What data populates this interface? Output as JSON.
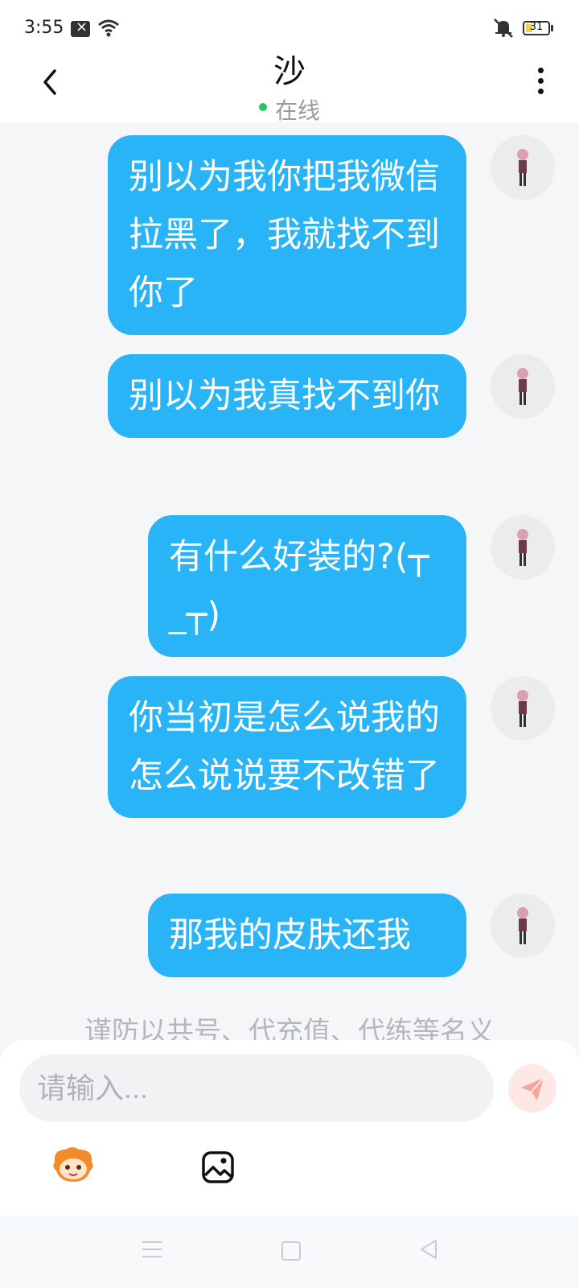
{
  "status_bar": {
    "time": "3:55",
    "battery": "31",
    "battery_level": 0.31
  },
  "header": {
    "title": "沙",
    "status": "在线",
    "icons": [
      "back-icon",
      "more-icon"
    ]
  },
  "messages": [
    {
      "text": "别以为我你把我微信拉黑了，我就找不到你了"
    },
    {
      "text": "别以为我真找不到你"
    },
    {
      "text": "有什么好装的?(┬_┬)"
    },
    {
      "text": "你当初是怎么说我的怎么说说要不改错了"
    },
    {
      "text": "那我的皮肤还我"
    }
  ],
  "notice": "谨防以共号、代充值、代练等名义",
  "composer": {
    "placeholder": "请输入...",
    "icons": [
      "send-icon",
      "emoji-icon",
      "image-icon"
    ]
  },
  "nav_bar": {
    "icons": [
      "menu-icon",
      "home-icon",
      "back-triangle-icon"
    ]
  },
  "colors": {
    "bubble": "#29b4f7",
    "online": "#22c55e",
    "send_bg": "#fde8e6",
    "send_icon": "#f7a49b"
  }
}
